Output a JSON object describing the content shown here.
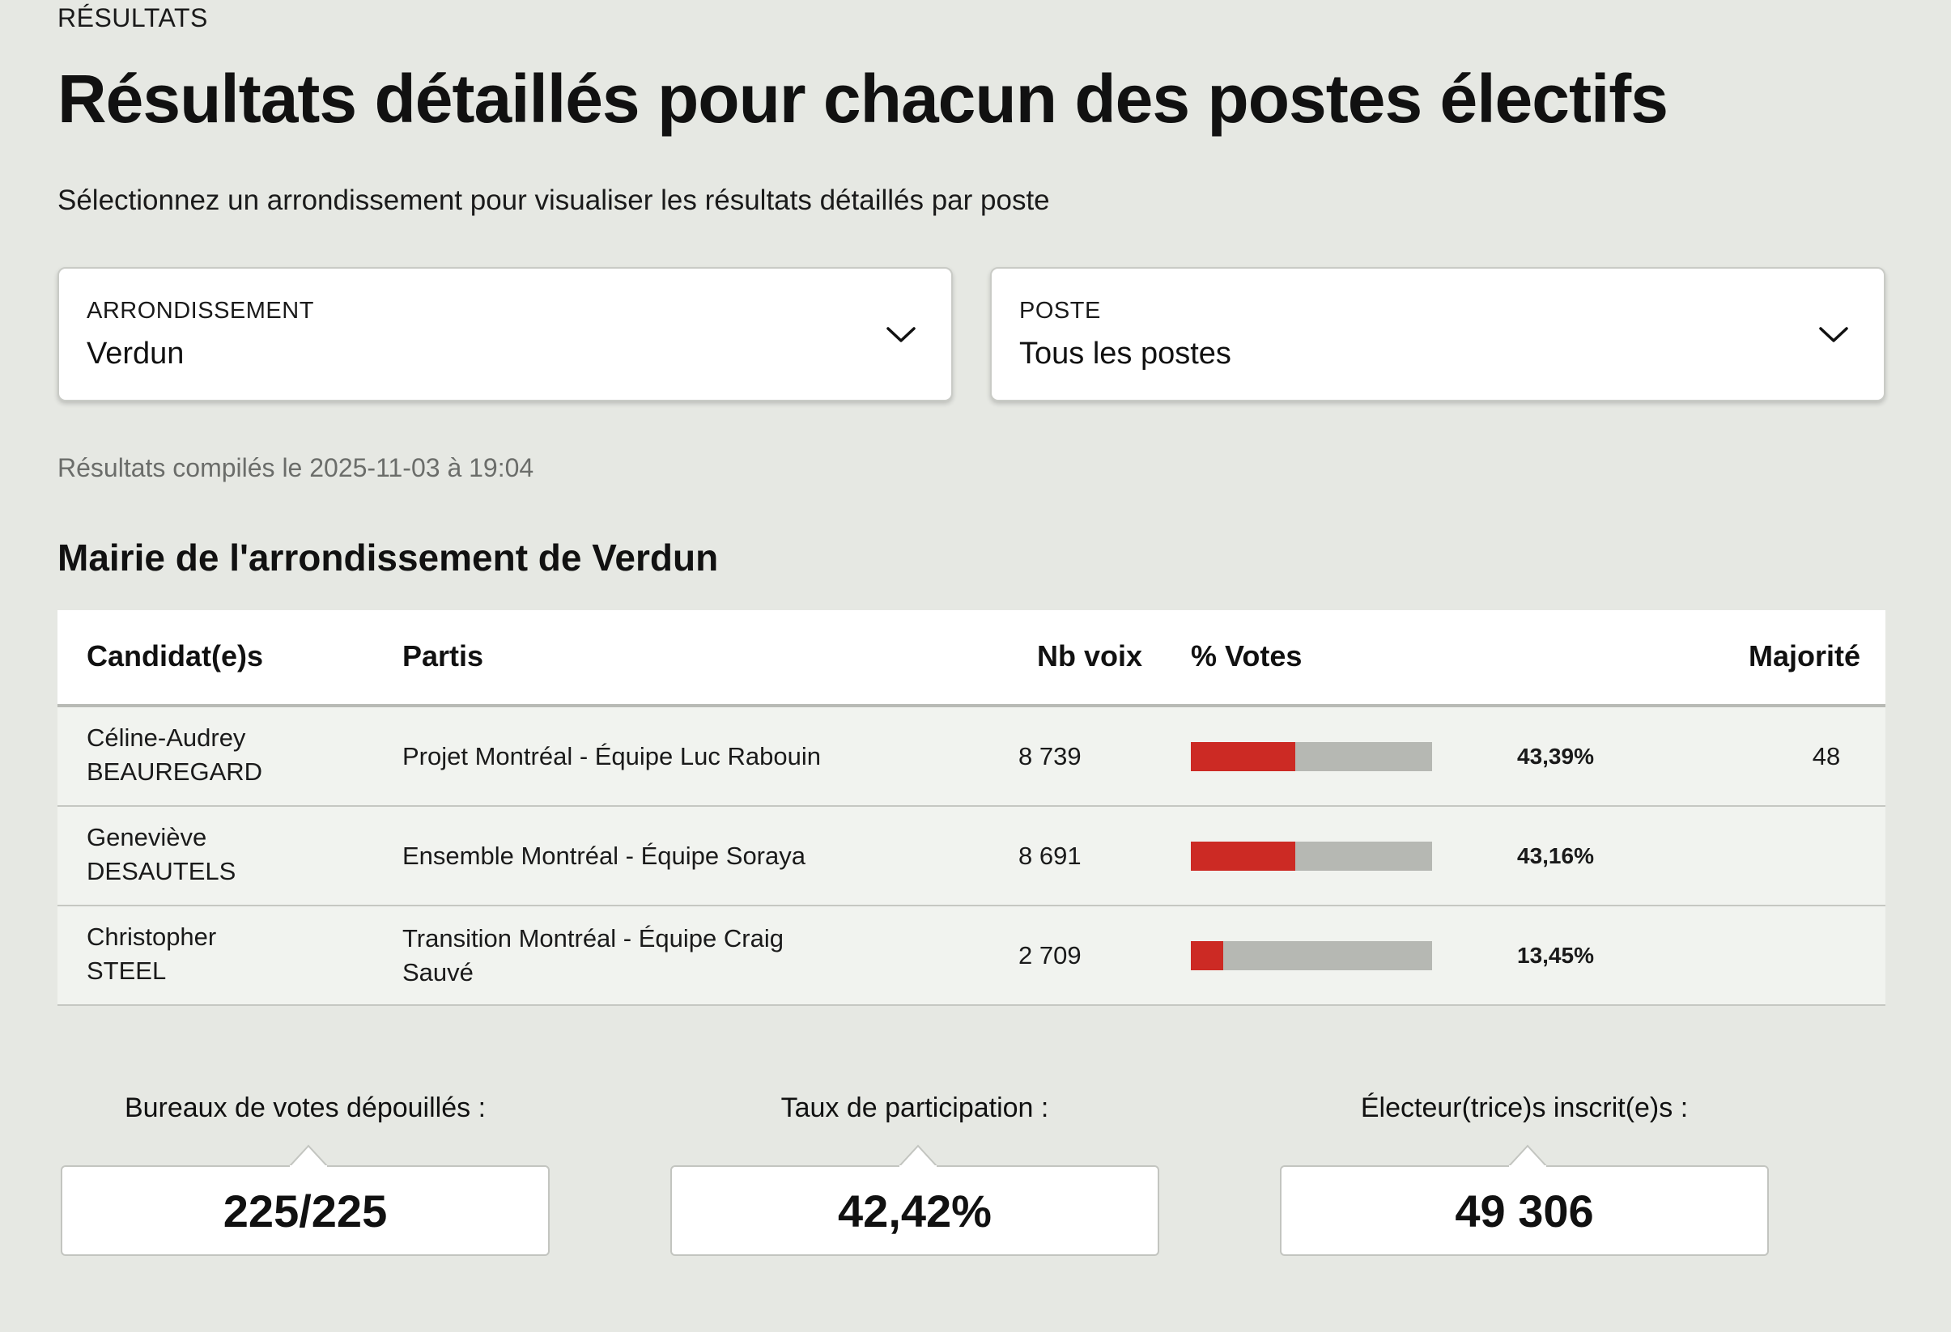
{
  "header": {
    "eyebrow": "RÉSULTATS",
    "title": "Résultats détaillés pour chacun des postes électifs",
    "subtitle": "Sélectionnez un arrondissement pour visualiser les résultats détaillés par poste"
  },
  "filters": {
    "arrondissement": {
      "label": "ARRONDISSEMENT",
      "value": "Verdun",
      "icon": "chevron-down-icon"
    },
    "poste": {
      "label": "POSTE",
      "value": "Tous les postes",
      "icon": "chevron-down-icon"
    }
  },
  "compiled": "Résultats compilés le 2025-11-03 à 19:04",
  "section": {
    "title": "Mairie de l'arrondissement de Verdun",
    "columns": {
      "candidates": "Candidat(e)s",
      "party": "Partis",
      "votes": "Nb voix",
      "pct": "% Votes",
      "majority": "Majorité"
    },
    "rows": [
      {
        "first": "Céline-Audrey",
        "last": "BEAUREGARD",
        "party": "Projet Montréal - Équipe Luc Rabouin",
        "votes": "8 739",
        "pct": "43,39%",
        "share": 0.4339,
        "majority": "48"
      },
      {
        "first": "Geneviève",
        "last": "DESAUTELS",
        "party": "Ensemble Montréal - Équipe Soraya",
        "votes": "8 691",
        "pct": "43,16%",
        "share": 0.4316,
        "majority": ""
      },
      {
        "first": "Christopher",
        "last": "STEEL",
        "party": "Transition Montréal - Équipe Craig Sauvé",
        "votes": "2 709",
        "pct": "13,45%",
        "share": 0.1345,
        "majority": ""
      }
    ]
  },
  "stats": {
    "bureaux": {
      "label": "Bureaux de votes dépouillés :",
      "value": "225/225"
    },
    "participation": {
      "label": "Taux de participation :",
      "value": "42,42%"
    },
    "inscrits": {
      "label": "Électeur(trice)s inscrit(e)s :",
      "value": "49 306"
    }
  },
  "colors": {
    "bar_fill": "#cc2a24",
    "bar_track": "#b6b8b3",
    "background": "#e6e8e3"
  }
}
